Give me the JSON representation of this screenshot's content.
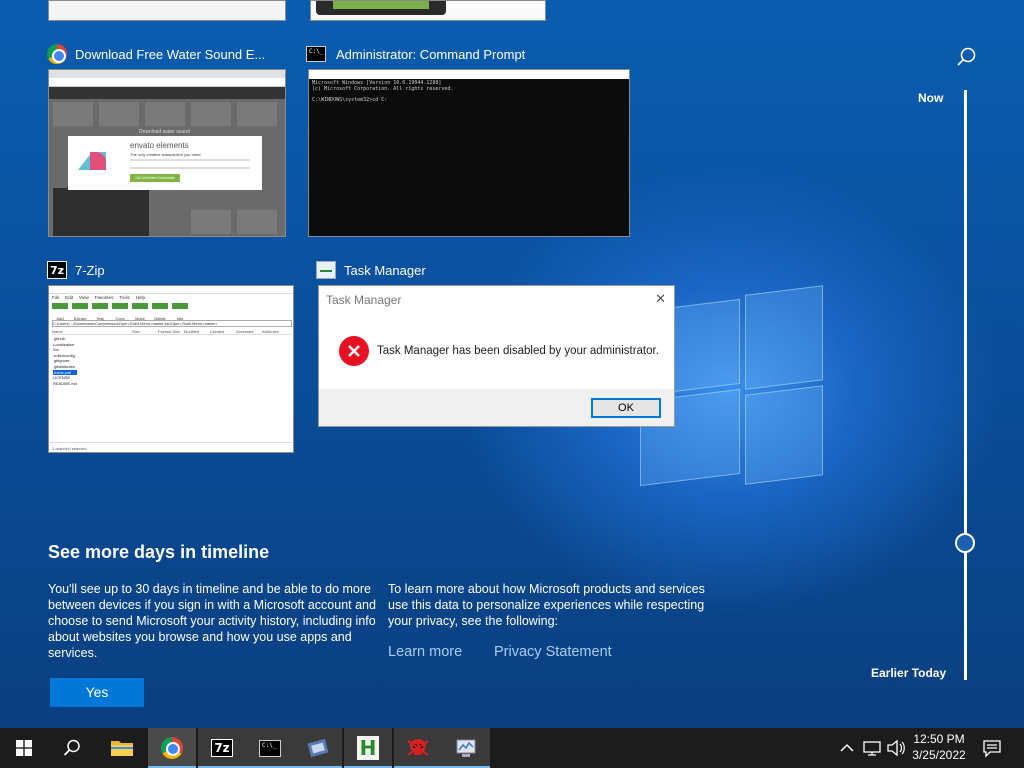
{
  "windows": [
    {
      "title": "Download Free Water Sound E...",
      "icon": "chrome-icon"
    },
    {
      "title": "Administrator: Command Prompt",
      "icon": "command-prompt-icon"
    },
    {
      "title": "7-Zip",
      "icon": "seven-zip-icon"
    },
    {
      "title": "Task Manager",
      "icon": "task-manager-icon"
    }
  ],
  "chrome_thumb": {
    "heading": "Download water sound",
    "brand": "envato elements",
    "tagline": "The only creative subscription you need",
    "button": "Get Unlimited Downloads"
  },
  "cmd_thumb": {
    "line1": "Microsoft Windows [Version 10.0.19044.1288]",
    "line2": "(c) Microsoft Corporation. All rights reserved.",
    "line3": "C:\\WINDOWS\\system32>cd C:"
  },
  "zip_thumb": {
    "menu": [
      "File",
      "Edit",
      "View",
      "Favorites",
      "Tools",
      "Help"
    ],
    "tools": [
      "Add",
      "Extract",
      "Test",
      "Copy",
      "Move",
      "Delete",
      "Info"
    ],
    "path": "C:\\Users\\...\\Downloads\\Compressed\\Open-Shell-Menu-master.zip\\Open-Shell-Menu-master\\",
    "columns": [
      "Name",
      "Size",
      "Packed Size",
      "Modified",
      "Created",
      "Accessed",
      "Attributes"
    ],
    "files": [
      ".github",
      "Localization",
      "Src",
      ".editorconfig",
      ".gitignore",
      ".gitattributes",
      ".travis.yml",
      "LICENSE",
      "README.md"
    ],
    "status": "1 object(s) selected"
  },
  "task_manager_dialog": {
    "title": "Task Manager",
    "message": "Task Manager has been disabled by your administrator.",
    "ok_label": "OK",
    "close_glyph": "✕"
  },
  "timeline": {
    "now_label": "Now",
    "earlier_label": "Earlier Today"
  },
  "promo": {
    "heading": "See more days in timeline",
    "left_lines": [
      "You'll see up to 30 days in timeline and be able to do more",
      "between devices if you sign in with a Microsoft account and",
      "choose to send Microsoft your activity history, including info",
      "about websites you browse and how you use apps and",
      "services."
    ],
    "right_lines": [
      "To learn more about how Microsoft products and services",
      "use this data to personalize experiences while respecting",
      "your privacy, see the following:"
    ],
    "learn_more": "Learn more",
    "privacy": "Privacy Statement",
    "yes_label": "Yes"
  },
  "taskbar": {
    "time": "12:50 PM",
    "date": "3/25/2022",
    "seven_zip_label": "7z",
    "h_app_label": "H"
  },
  "colors": {
    "accent": "#0078d7",
    "link": "#a8cdf2",
    "taskbar": "#1c1c1c",
    "error": "#e81123"
  }
}
